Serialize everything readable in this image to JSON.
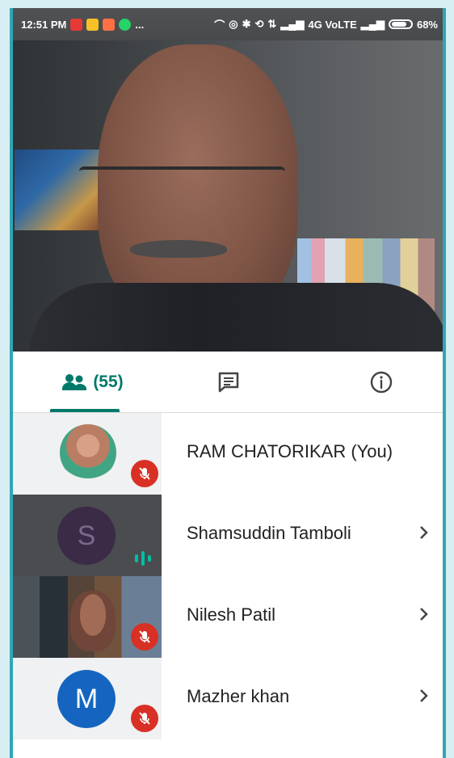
{
  "status_bar": {
    "time": "12:51 PM",
    "ellipsis": "...",
    "network_label": "4G VoLTE",
    "battery_percent": "68%"
  },
  "tabs": {
    "people_count": "(55)",
    "active_tab": "people"
  },
  "participants": [
    {
      "name": "RAM CHATORIKAR (You)",
      "avatar_type": "photo",
      "mic_muted": true,
      "has_chevron": false
    },
    {
      "name": "Shamsuddin Tamboli",
      "avatar_type": "letter",
      "avatar_letter": "S",
      "avatar_color": "#3b2b46",
      "tile_color": "#4a4c4f",
      "speaking": true,
      "has_chevron": true
    },
    {
      "name": "Nilesh Patil",
      "avatar_type": "video",
      "mic_muted": true,
      "has_chevron": true
    },
    {
      "name": "Mazher khan",
      "avatar_type": "letter",
      "avatar_letter": "M",
      "avatar_color": "#1565c0",
      "tile_color": "#f0f1f2",
      "mic_muted": true,
      "has_chevron": true
    }
  ],
  "colors": {
    "accent": "#00796b",
    "mic_off": "#d93025",
    "speaking": "#00bfa5",
    "frame": "#2ea7b6"
  }
}
